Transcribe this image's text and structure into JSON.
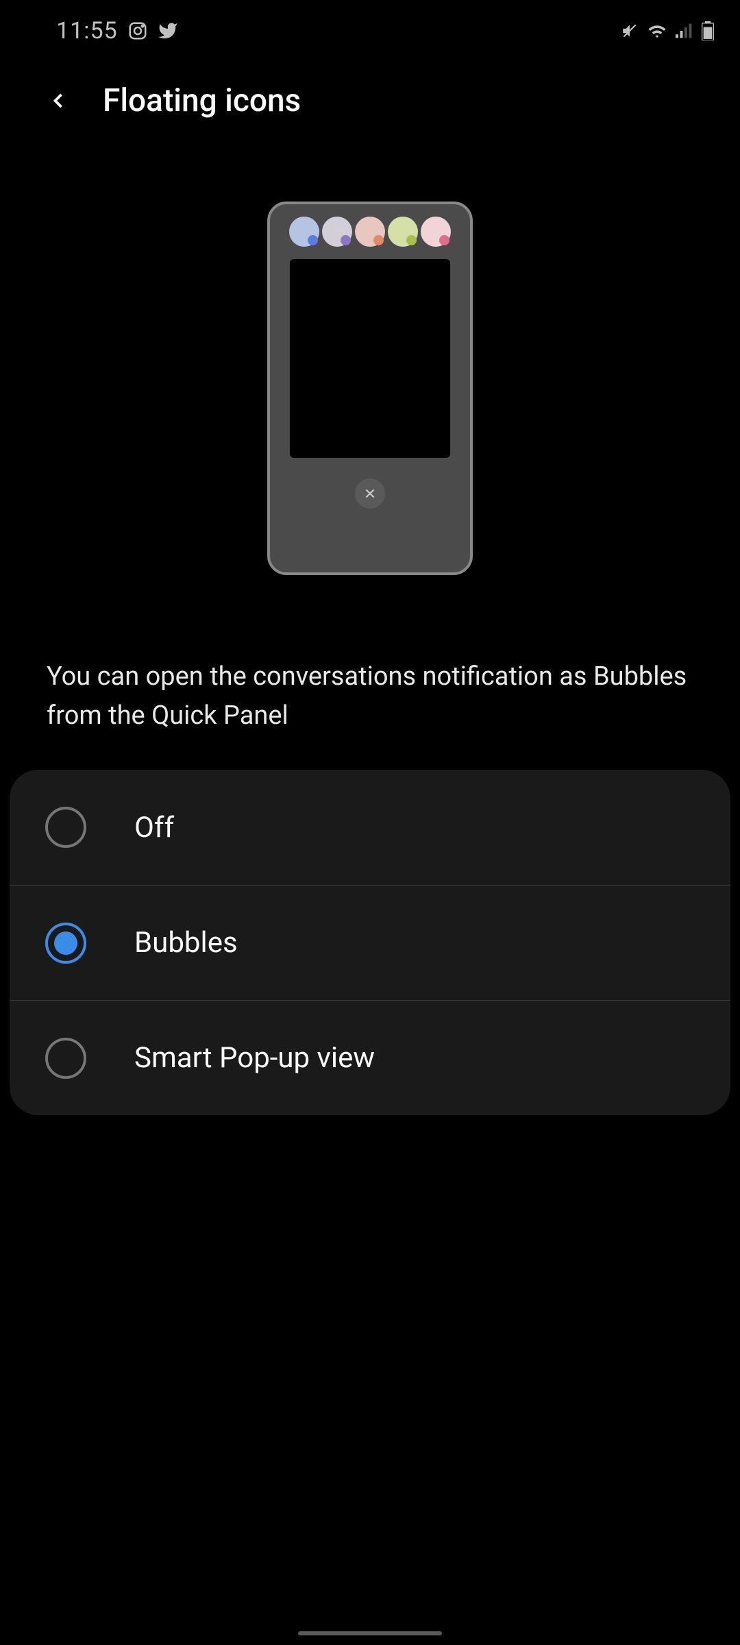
{
  "status": {
    "time": "11:55"
  },
  "header": {
    "title": "Floating icons"
  },
  "description": "You can open the conversations notification as Bubbles from the Quick Panel",
  "options": [
    {
      "label": "Off",
      "selected": false
    },
    {
      "label": "Bubbles",
      "selected": true
    },
    {
      "label": "Smart Pop-up view",
      "selected": false
    }
  ]
}
